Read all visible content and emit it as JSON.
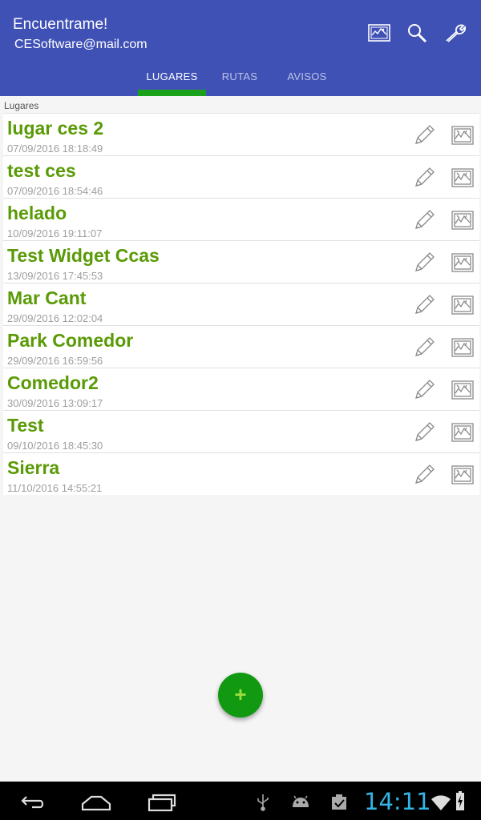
{
  "header": {
    "title": "Encuentrame!",
    "subtitle": "CESoftware@mail.com",
    "icons": {
      "map": "map-icon",
      "search": "search-icon",
      "settings": "wrench-icon"
    },
    "color": "#3f51b5"
  },
  "tabs": [
    {
      "label": "LUGARES",
      "active": true
    },
    {
      "label": "RUTAS",
      "active": false
    },
    {
      "label": "AVISOS",
      "active": false
    }
  ],
  "section": {
    "label": "Lugares"
  },
  "places": [
    {
      "name": "lugar ces 2",
      "date": "07/09/2016 18:18:49"
    },
    {
      "name": "test ces",
      "date": "07/09/2016 18:54:46"
    },
    {
      "name": "helado",
      "date": "10/09/2016 19:11:07"
    },
    {
      "name": "Test Widget Ccas",
      "date": "13/09/2016 17:45:53"
    },
    {
      "name": "Mar Cant",
      "date": "29/09/2016 12:02:04"
    },
    {
      "name": "Park Comedor",
      "date": "29/09/2016 16:59:56"
    },
    {
      "name": "Comedor2",
      "date": "30/09/2016 13:09:17"
    },
    {
      "name": "Test",
      "date": "09/10/2016 18:45:30"
    },
    {
      "name": "Sierra",
      "date": "11/10/2016 14:55:21"
    }
  ],
  "fab": {
    "label": "+"
  },
  "status": {
    "time": "14:11"
  },
  "colors": {
    "accent": "#5a9a06",
    "fab": "#119911",
    "clock": "#33b5e5"
  }
}
